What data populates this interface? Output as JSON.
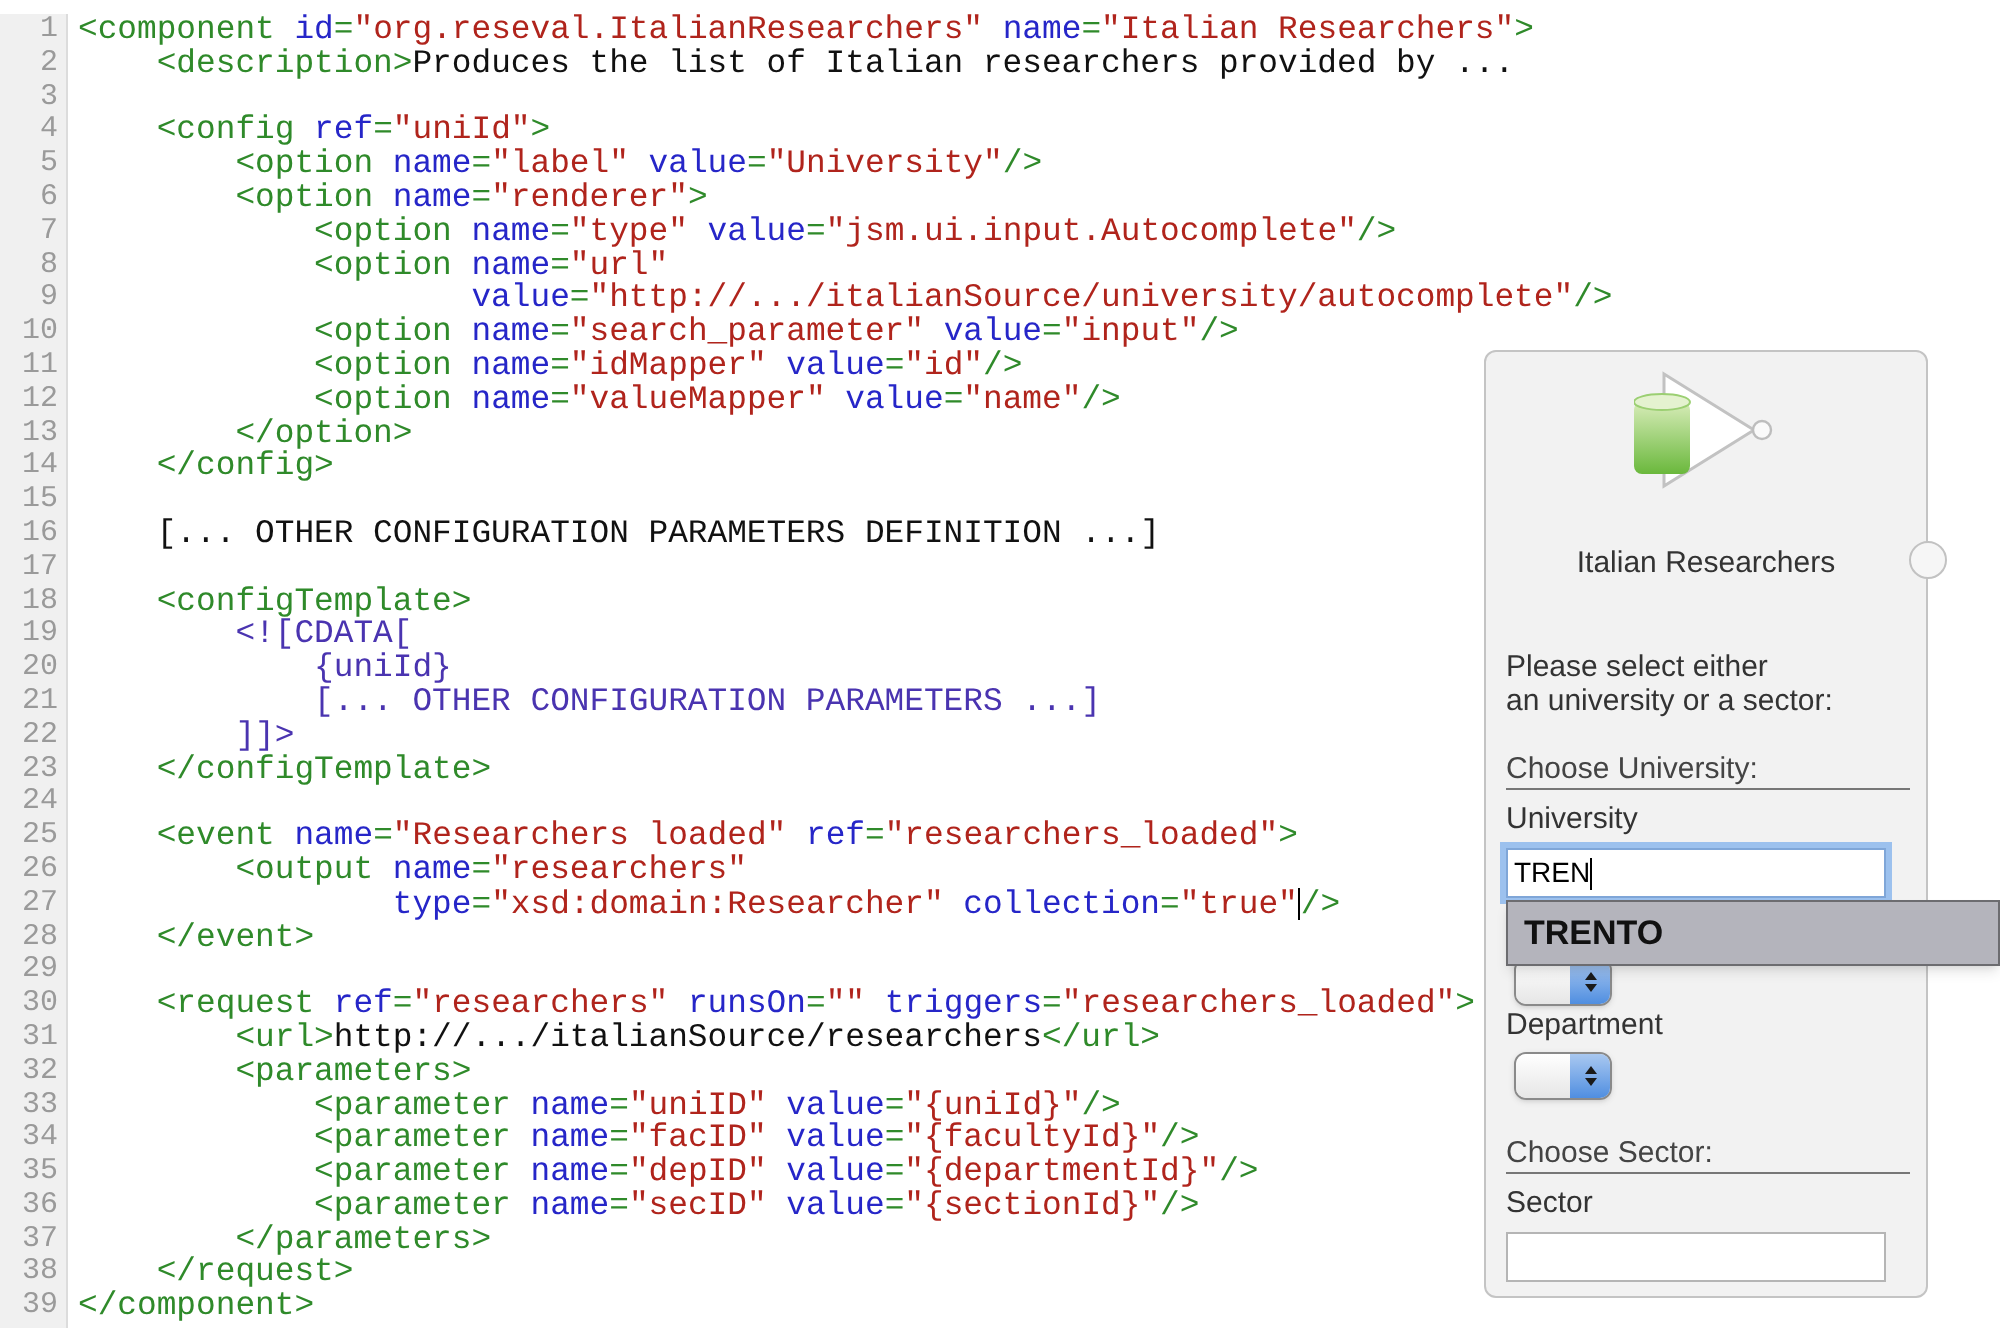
{
  "editor": {
    "lines": [
      {
        "number": "1",
        "tokens": [
          {
            "kind": "tag",
            "text": "<component"
          },
          {
            "kind": "attr",
            "text": " id"
          },
          {
            "kind": "tag",
            "text": "="
          },
          {
            "kind": "str",
            "text": "\"org.reseval.ItalianResearchers\""
          },
          {
            "kind": "attr",
            "text": " name"
          },
          {
            "kind": "tag",
            "text": "="
          },
          {
            "kind": "str",
            "text": "\"Italian Researchers\""
          },
          {
            "kind": "tag",
            "text": ">"
          }
        ]
      },
      {
        "number": "2",
        "tokens": [
          {
            "kind": "tag",
            "text": "    <description>"
          },
          {
            "kind": "text",
            "text": "Produces the list of Italian researchers provided by ..."
          }
        ]
      },
      {
        "number": "3"
      },
      {
        "number": "4",
        "tokens": [
          {
            "kind": "tag",
            "text": "    <config"
          },
          {
            "kind": "attr",
            "text": " ref"
          },
          {
            "kind": "tag",
            "text": "="
          },
          {
            "kind": "str",
            "text": "\"uniId\""
          },
          {
            "kind": "tag",
            "text": ">"
          }
        ]
      },
      {
        "number": "5",
        "tokens": [
          {
            "kind": "tag",
            "text": "        <option"
          },
          {
            "kind": "attr",
            "text": " name"
          },
          {
            "kind": "tag",
            "text": "="
          },
          {
            "kind": "str",
            "text": "\"label\""
          },
          {
            "kind": "attr",
            "text": " value"
          },
          {
            "kind": "tag",
            "text": "="
          },
          {
            "kind": "str",
            "text": "\"University\""
          },
          {
            "kind": "tag",
            "text": "/>"
          }
        ]
      },
      {
        "number": "6",
        "tokens": [
          {
            "kind": "tag",
            "text": "        <option"
          },
          {
            "kind": "attr",
            "text": " name"
          },
          {
            "kind": "tag",
            "text": "="
          },
          {
            "kind": "str",
            "text": "\"renderer\""
          },
          {
            "kind": "tag",
            "text": ">"
          }
        ]
      },
      {
        "number": "7",
        "tokens": [
          {
            "kind": "tag",
            "text": "            <option"
          },
          {
            "kind": "attr",
            "text": " name"
          },
          {
            "kind": "tag",
            "text": "="
          },
          {
            "kind": "str",
            "text": "\"type\""
          },
          {
            "kind": "attr",
            "text": " value"
          },
          {
            "kind": "tag",
            "text": "="
          },
          {
            "kind": "str",
            "text": "\"jsm.ui.input.Autocomplete\""
          },
          {
            "kind": "tag",
            "text": "/>"
          }
        ]
      },
      {
        "number": "8",
        "tokens": [
          {
            "kind": "tag",
            "text": "            <option"
          },
          {
            "kind": "attr",
            "text": " name"
          },
          {
            "kind": "tag",
            "text": "="
          },
          {
            "kind": "str",
            "text": "\"url\""
          }
        ]
      },
      {
        "number": "9",
        "tokens": [
          {
            "kind": "attr",
            "text": "                    value"
          },
          {
            "kind": "tag",
            "text": "="
          },
          {
            "kind": "str",
            "text": "\"http://.../italianSource/university/autocomplete\""
          },
          {
            "kind": "tag",
            "text": "/>"
          }
        ]
      },
      {
        "number": "10",
        "tokens": [
          {
            "kind": "tag",
            "text": "            <option"
          },
          {
            "kind": "attr",
            "text": " name"
          },
          {
            "kind": "tag",
            "text": "="
          },
          {
            "kind": "str",
            "text": "\"search_parameter\""
          },
          {
            "kind": "attr",
            "text": " value"
          },
          {
            "kind": "tag",
            "text": "="
          },
          {
            "kind": "str",
            "text": "\"input\""
          },
          {
            "kind": "tag",
            "text": "/>"
          }
        ]
      },
      {
        "number": "11",
        "tokens": [
          {
            "kind": "tag",
            "text": "            <option"
          },
          {
            "kind": "attr",
            "text": " name"
          },
          {
            "kind": "tag",
            "text": "="
          },
          {
            "kind": "str",
            "text": "\"idMapper\""
          },
          {
            "kind": "attr",
            "text": " value"
          },
          {
            "kind": "tag",
            "text": "="
          },
          {
            "kind": "str",
            "text": "\"id\""
          },
          {
            "kind": "tag",
            "text": "/>"
          }
        ]
      },
      {
        "number": "12",
        "tokens": [
          {
            "kind": "tag",
            "text": "            <option"
          },
          {
            "kind": "attr",
            "text": " name"
          },
          {
            "kind": "tag",
            "text": "="
          },
          {
            "kind": "str",
            "text": "\"valueMapper\""
          },
          {
            "kind": "attr",
            "text": " value"
          },
          {
            "kind": "tag",
            "text": "="
          },
          {
            "kind": "str",
            "text": "\"name\""
          },
          {
            "kind": "tag",
            "text": "/>"
          }
        ]
      },
      {
        "number": "13",
        "tokens": [
          {
            "kind": "tag",
            "text": "        </option>"
          }
        ]
      },
      {
        "number": "14",
        "tokens": [
          {
            "kind": "tag",
            "text": "    </config>"
          }
        ]
      },
      {
        "number": "15"
      },
      {
        "number": "16",
        "tokens": [
          {
            "kind": "text",
            "text": "    [... OTHER CONFIGURATION PARAMETERS DEFINITION ...]"
          }
        ]
      },
      {
        "number": "17"
      },
      {
        "number": "18",
        "tokens": [
          {
            "kind": "tag",
            "text": "    <configTemplate>"
          }
        ]
      },
      {
        "number": "19",
        "tokens": [
          {
            "kind": "cdata",
            "text": "        <![CDATA["
          }
        ]
      },
      {
        "number": "20",
        "tokens": [
          {
            "kind": "cdata",
            "text": "            {uniId}"
          }
        ]
      },
      {
        "number": "21",
        "tokens": [
          {
            "kind": "cdata",
            "text": "            [... OTHER CONFIGURATION PARAMETERS ...]"
          }
        ]
      },
      {
        "number": "22",
        "tokens": [
          {
            "kind": "cdata",
            "text": "        ]]>"
          }
        ]
      },
      {
        "number": "23",
        "tokens": [
          {
            "kind": "tag",
            "text": "    </configTemplate>"
          }
        ]
      },
      {
        "number": "24"
      },
      {
        "number": "25",
        "tokens": [
          {
            "kind": "tag",
            "text": "    <event"
          },
          {
            "kind": "attr",
            "text": " name"
          },
          {
            "kind": "tag",
            "text": "="
          },
          {
            "kind": "str",
            "text": "\"Researchers loaded\""
          },
          {
            "kind": "attr",
            "text": " ref"
          },
          {
            "kind": "tag",
            "text": "="
          },
          {
            "kind": "str",
            "text": "\"researchers_loaded\""
          },
          {
            "kind": "tag",
            "text": ">"
          }
        ]
      },
      {
        "number": "26",
        "tokens": [
          {
            "kind": "tag",
            "text": "        <output"
          },
          {
            "kind": "attr",
            "text": " name"
          },
          {
            "kind": "tag",
            "text": "="
          },
          {
            "kind": "str",
            "text": "\"researchers\""
          }
        ]
      },
      {
        "number": "27",
        "tokens": [
          {
            "kind": "attr",
            "text": "                type"
          },
          {
            "kind": "tag",
            "text": "="
          },
          {
            "kind": "str",
            "text": "\"xsd:domain:Researcher\""
          },
          {
            "kind": "attr",
            "text": " collection"
          },
          {
            "kind": "tag",
            "text": "="
          },
          {
            "kind": "str",
            "text": "\"true\""
          },
          {
            "kind": "caret"
          },
          {
            "kind": "tag",
            "text": "/>"
          }
        ]
      },
      {
        "number": "28",
        "tokens": [
          {
            "kind": "tag",
            "text": "    </event>"
          }
        ]
      },
      {
        "number": "29"
      },
      {
        "number": "30",
        "tokens": [
          {
            "kind": "tag",
            "text": "    <request"
          },
          {
            "kind": "attr",
            "text": " ref"
          },
          {
            "kind": "tag",
            "text": "="
          },
          {
            "kind": "str",
            "text": "\"researchers\""
          },
          {
            "kind": "attr",
            "text": " runsOn"
          },
          {
            "kind": "tag",
            "text": "="
          },
          {
            "kind": "str",
            "text": "\"\""
          },
          {
            "kind": "attr",
            "text": " triggers"
          },
          {
            "kind": "tag",
            "text": "="
          },
          {
            "kind": "str",
            "text": "\"researchers_loaded\""
          },
          {
            "kind": "tag",
            "text": ">"
          }
        ]
      },
      {
        "number": "31",
        "tokens": [
          {
            "kind": "tag",
            "text": "        <url>"
          },
          {
            "kind": "text",
            "text": "http://.../italianSource/researchers"
          },
          {
            "kind": "tag",
            "text": "</url>"
          }
        ]
      },
      {
        "number": "32",
        "tokens": [
          {
            "kind": "tag",
            "text": "        <parameters>"
          }
        ]
      },
      {
        "number": "33",
        "tokens": [
          {
            "kind": "tag",
            "text": "            <parameter"
          },
          {
            "kind": "attr",
            "text": " name"
          },
          {
            "kind": "tag",
            "text": "="
          },
          {
            "kind": "str",
            "text": "\"uniID\""
          },
          {
            "kind": "attr",
            "text": " value"
          },
          {
            "kind": "tag",
            "text": "="
          },
          {
            "kind": "str",
            "text": "\"{uniId}\""
          },
          {
            "kind": "tag",
            "text": "/>"
          }
        ]
      },
      {
        "number": "34",
        "tokens": [
          {
            "kind": "tag",
            "text": "            <parameter"
          },
          {
            "kind": "attr",
            "text": " name"
          },
          {
            "kind": "tag",
            "text": "="
          },
          {
            "kind": "str",
            "text": "\"facID\""
          },
          {
            "kind": "attr",
            "text": " value"
          },
          {
            "kind": "tag",
            "text": "="
          },
          {
            "kind": "str",
            "text": "\"{facultyId}\""
          },
          {
            "kind": "tag",
            "text": "/>"
          }
        ]
      },
      {
        "number": "35",
        "tokens": [
          {
            "kind": "tag",
            "text": "            <parameter"
          },
          {
            "kind": "attr",
            "text": " name"
          },
          {
            "kind": "tag",
            "text": "="
          },
          {
            "kind": "str",
            "text": "\"depID\""
          },
          {
            "kind": "attr",
            "text": " value"
          },
          {
            "kind": "tag",
            "text": "="
          },
          {
            "kind": "str",
            "text": "\"{departmentId}\""
          },
          {
            "kind": "tag",
            "text": "/>"
          }
        ]
      },
      {
        "number": "36",
        "tokens": [
          {
            "kind": "tag",
            "text": "            <parameter"
          },
          {
            "kind": "attr",
            "text": " name"
          },
          {
            "kind": "tag",
            "text": "="
          },
          {
            "kind": "str",
            "text": "\"secID\""
          },
          {
            "kind": "attr",
            "text": " value"
          },
          {
            "kind": "tag",
            "text": "="
          },
          {
            "kind": "str",
            "text": "\"{sectionId}\""
          },
          {
            "kind": "tag",
            "text": "/>"
          }
        ]
      },
      {
        "number": "37",
        "tokens": [
          {
            "kind": "tag",
            "text": "        </parameters>"
          }
        ]
      },
      {
        "number": "38",
        "tokens": [
          {
            "kind": "tag",
            "text": "    </request>"
          }
        ]
      },
      {
        "number": "39",
        "tokens": [
          {
            "kind": "tag",
            "text": "</component>"
          }
        ]
      }
    ]
  },
  "component_panel": {
    "title": "Italian Researchers",
    "instructions": "Please select either\nan university or a sector:",
    "sections": [
      {
        "heading": "Choose University:",
        "fields": [
          {
            "kind": "text",
            "label": "University",
            "value": "TREN",
            "focused": true,
            "suggestions": [
              "TRENTO"
            ]
          },
          {
            "kind": "select"
          },
          {
            "kind": "select",
            "label": "Department"
          }
        ]
      },
      {
        "heading": "Choose Sector:",
        "fields": [
          {
            "kind": "text",
            "label": "Sector",
            "focused": false
          }
        ]
      }
    ]
  }
}
